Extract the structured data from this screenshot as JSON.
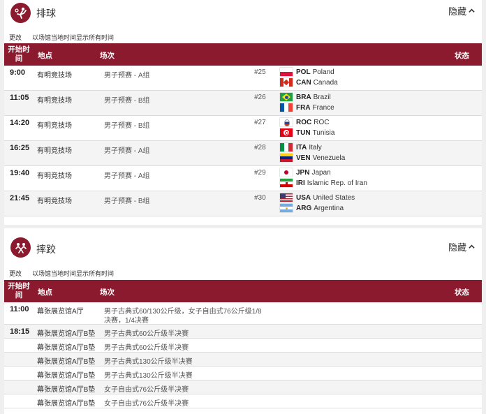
{
  "sections": [
    {
      "icon": "volleyball-player-icon",
      "title": "排球",
      "hide_label": "隐藏",
      "change_label": "更改",
      "timezone_note": "以场馆当地时间显示所有时间",
      "headers": {
        "time": "开始时间",
        "venue": "地点",
        "event": "场次",
        "status": "状态"
      },
      "rows": [
        {
          "time": "9:00",
          "venue": "有明竞技场",
          "event": "男子预赛 - A组",
          "match": "#25",
          "teams": [
            {
              "code": "POL",
              "name": "Poland",
              "flag": "pol"
            },
            {
              "code": "CAN",
              "name": "Canada",
              "flag": "can"
            }
          ]
        },
        {
          "time": "11:05",
          "venue": "有明竞技场",
          "event": "男子预赛 - B组",
          "match": "#26",
          "teams": [
            {
              "code": "BRA",
              "name": "Brazil",
              "flag": "bra"
            },
            {
              "code": "FRA",
              "name": "France",
              "flag": "fra"
            }
          ]
        },
        {
          "time": "14:20",
          "venue": "有明竞技场",
          "event": "男子预赛 - B组",
          "match": "#27",
          "teams": [
            {
              "code": "ROC",
              "name": "ROC",
              "flag": "roc"
            },
            {
              "code": "TUN",
              "name": "Tunisia",
              "flag": "tun"
            }
          ]
        },
        {
          "time": "16:25",
          "venue": "有明竞技场",
          "event": "男子预赛 - A组",
          "match": "#28",
          "teams": [
            {
              "code": "ITA",
              "name": "Italy",
              "flag": "ita"
            },
            {
              "code": "VEN",
              "name": "Venezuela",
              "flag": "ven"
            }
          ]
        },
        {
          "time": "19:40",
          "venue": "有明竞技场",
          "event": "男子预赛 - A组",
          "match": "#29",
          "teams": [
            {
              "code": "JPN",
              "name": "Japan",
              "flag": "jpn"
            },
            {
              "code": "IRI",
              "name": "Islamic Rep. of Iran",
              "flag": "iri"
            }
          ]
        },
        {
          "time": "21:45",
          "venue": "有明竞技场",
          "event": "男子预赛 - B组",
          "match": "#30",
          "teams": [
            {
              "code": "USA",
              "name": "United States",
              "flag": "usa"
            },
            {
              "code": "ARG",
              "name": "Argentina",
              "flag": "arg"
            }
          ]
        }
      ]
    },
    {
      "icon": "wrestling-icon",
      "title": "摔跤",
      "hide_label": "隐藏",
      "change_label": "更改",
      "timezone_note": "以场馆当地时间显示所有时间",
      "headers": {
        "time": "开始时间",
        "venue": "地点",
        "event": "场次",
        "status": "状态"
      },
      "rows": [
        {
          "time": "11:00",
          "venue": "幕张展览馆A厅",
          "event_lines": [
            "男子古典式60/130公斤级，女子自由式76公斤级1/8",
            "决赛，1/4决赛"
          ]
        },
        {
          "time": "18:15",
          "venue": "幕张展览馆A厅B垫",
          "event_lines": [
            "男子古典式60公斤级半决赛"
          ]
        },
        {
          "time": "",
          "venue": "幕张展览馆A厅B垫",
          "event_lines": [
            "男子古典式60公斤级半决赛"
          ]
        },
        {
          "time": "",
          "venue": "幕张展览馆A厅B垫",
          "event_lines": [
            "男子古典式130公斤级半决赛"
          ]
        },
        {
          "time": "",
          "venue": "幕张展览馆A厅B垫",
          "event_lines": [
            "男子古典式130公斤级半决赛"
          ]
        },
        {
          "time": "",
          "venue": "幕张展览馆A厅B垫",
          "event_lines": [
            "女子自由式76公斤级半决赛"
          ]
        },
        {
          "time": "",
          "venue": "幕张展览馆A厅B垫",
          "event_lines": [
            "女子自由式76公斤级半决赛"
          ]
        }
      ]
    }
  ],
  "colors": {
    "accent": "#8b1a2f",
    "row_alt": "#f4f4f4"
  }
}
